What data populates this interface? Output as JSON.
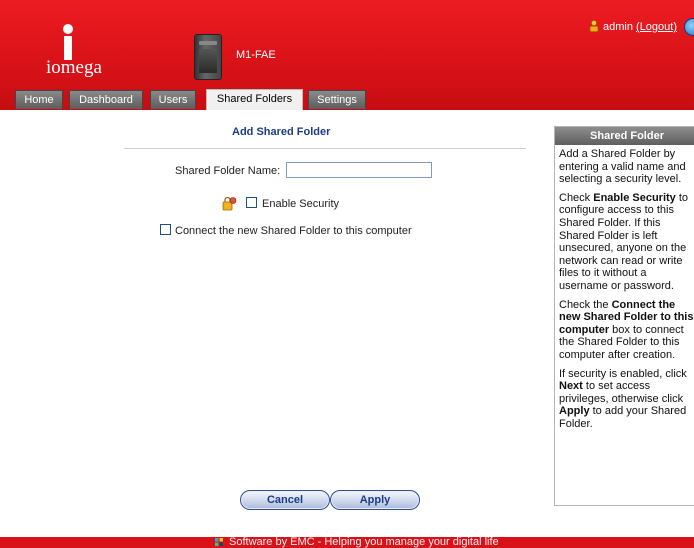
{
  "brand": {
    "logo_text": "iomega"
  },
  "device": {
    "name": "M1-FAE"
  },
  "user": {
    "name": "admin",
    "logout_label": "(Logout)"
  },
  "tabs": [
    {
      "label": "Home",
      "active": false
    },
    {
      "label": "Dashboard",
      "active": false
    },
    {
      "label": "Users",
      "active": false
    },
    {
      "label": "Shared Folders",
      "active": true
    },
    {
      "label": "Settings",
      "active": false
    }
  ],
  "form": {
    "title": "Add Shared Folder",
    "name_label": "Shared Folder Name:",
    "name_value": "",
    "enable_security_label": "Enable Security",
    "enable_security_checked": false,
    "connect_label": "Connect the new Shared Folder to this computer",
    "connect_checked": false
  },
  "buttons": {
    "cancel": "Cancel",
    "apply": "Apply"
  },
  "help": {
    "title": "Shared Folder",
    "p1": "Add a Shared Folder by entering a valid name and selecting a security level.",
    "p2_pre": "Check ",
    "p2_bold": "Enable Security",
    "p2_post": " to configure access to this Shared Folder. If this Shared Folder is left unsecured, anyone on the network can read or write files to it without a username or password.",
    "p3_pre": "Check the ",
    "p3_bold": "Connect the new Shared Folder to this computer",
    "p3_post": " box to connect the Shared Folder to this computer after creation.",
    "p4_pre": "If security is enabled, click ",
    "p4_bold1": "Next",
    "p4_mid": " to set access privileges, otherwise click ",
    "p4_bold2": "Apply",
    "p4_post": " to add your Shared Folder."
  },
  "footer": {
    "text": "Software by EMC - Helping you manage your digital life"
  },
  "colors": {
    "header_red": "#d81218",
    "title_blue": "#1c3c83",
    "tab_grey": "#6e6e6e"
  },
  "icons": {
    "user": "user-icon",
    "globe": "globe-icon",
    "lock": "security-lock-icon",
    "emc": "emc-logo-icon"
  }
}
